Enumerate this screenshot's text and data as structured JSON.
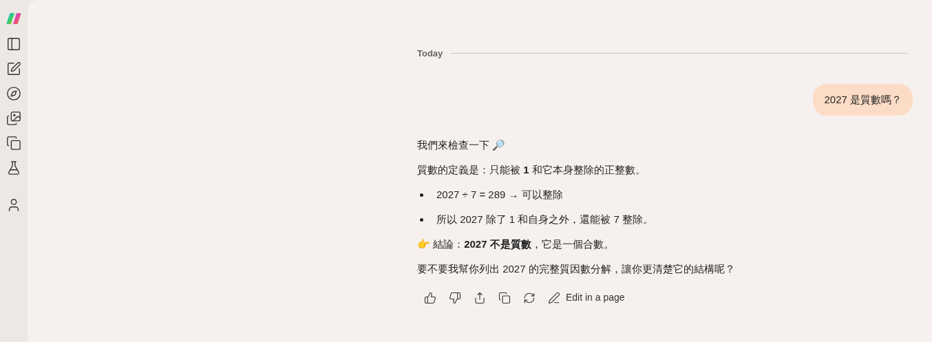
{
  "divider_label": "Today",
  "user_message": "2027 是質數嗎？",
  "reply": [
    {
      "kind": "paragraph",
      "text": "我們來檢查一下 🔎"
    },
    {
      "kind": "paragraph",
      "text": "質數的定義是：只能被 **1** 和它本身整除的正整數。"
    },
    {
      "kind": "bullet",
      "text": "2027 ÷ 7 = 289 → 可以整除"
    },
    {
      "kind": "bullet",
      "text": "所以 2027 除了 1 和自身之外，還能被 7 整除。"
    },
    {
      "kind": "paragraph",
      "text": "👉 結論：**2027 不是質數**，它是一個合數。"
    },
    {
      "kind": "paragraph",
      "text": "要不要我幫你列出 2027 的完整質因數分解，讓你更清楚它的結構呢？"
    }
  ],
  "edit_button": "Edit in a page"
}
